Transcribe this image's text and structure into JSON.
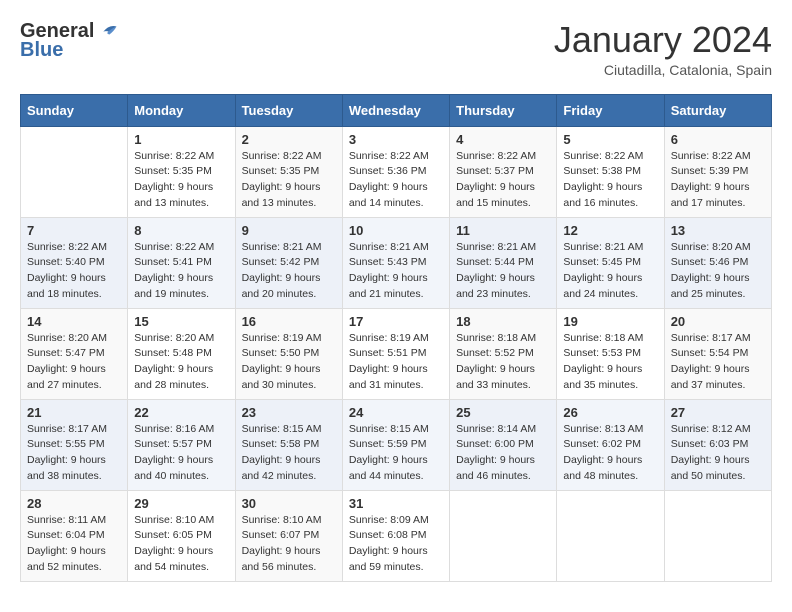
{
  "header": {
    "logo_general": "General",
    "logo_blue": "Blue",
    "month_title": "January 2024",
    "location": "Ciutadilla, Catalonia, Spain"
  },
  "days_of_week": [
    "Sunday",
    "Monday",
    "Tuesday",
    "Wednesday",
    "Thursday",
    "Friday",
    "Saturday"
  ],
  "weeks": [
    [
      {
        "day": "",
        "info": ""
      },
      {
        "day": "1",
        "info": "Sunrise: 8:22 AM\nSunset: 5:35 PM\nDaylight: 9 hours\nand 13 minutes."
      },
      {
        "day": "2",
        "info": "Sunrise: 8:22 AM\nSunset: 5:35 PM\nDaylight: 9 hours\nand 13 minutes."
      },
      {
        "day": "3",
        "info": "Sunrise: 8:22 AM\nSunset: 5:36 PM\nDaylight: 9 hours\nand 14 minutes."
      },
      {
        "day": "4",
        "info": "Sunrise: 8:22 AM\nSunset: 5:37 PM\nDaylight: 9 hours\nand 15 minutes."
      },
      {
        "day": "5",
        "info": "Sunrise: 8:22 AM\nSunset: 5:38 PM\nDaylight: 9 hours\nand 16 minutes."
      },
      {
        "day": "6",
        "info": "Sunrise: 8:22 AM\nSunset: 5:39 PM\nDaylight: 9 hours\nand 17 minutes."
      }
    ],
    [
      {
        "day": "7",
        "info": "Sunrise: 8:22 AM\nSunset: 5:40 PM\nDaylight: 9 hours\nand 18 minutes."
      },
      {
        "day": "8",
        "info": "Sunrise: 8:22 AM\nSunset: 5:41 PM\nDaylight: 9 hours\nand 19 minutes."
      },
      {
        "day": "9",
        "info": "Sunrise: 8:21 AM\nSunset: 5:42 PM\nDaylight: 9 hours\nand 20 minutes."
      },
      {
        "day": "10",
        "info": "Sunrise: 8:21 AM\nSunset: 5:43 PM\nDaylight: 9 hours\nand 21 minutes."
      },
      {
        "day": "11",
        "info": "Sunrise: 8:21 AM\nSunset: 5:44 PM\nDaylight: 9 hours\nand 23 minutes."
      },
      {
        "day": "12",
        "info": "Sunrise: 8:21 AM\nSunset: 5:45 PM\nDaylight: 9 hours\nand 24 minutes."
      },
      {
        "day": "13",
        "info": "Sunrise: 8:20 AM\nSunset: 5:46 PM\nDaylight: 9 hours\nand 25 minutes."
      }
    ],
    [
      {
        "day": "14",
        "info": "Sunrise: 8:20 AM\nSunset: 5:47 PM\nDaylight: 9 hours\nand 27 minutes."
      },
      {
        "day": "15",
        "info": "Sunrise: 8:20 AM\nSunset: 5:48 PM\nDaylight: 9 hours\nand 28 minutes."
      },
      {
        "day": "16",
        "info": "Sunrise: 8:19 AM\nSunset: 5:50 PM\nDaylight: 9 hours\nand 30 minutes."
      },
      {
        "day": "17",
        "info": "Sunrise: 8:19 AM\nSunset: 5:51 PM\nDaylight: 9 hours\nand 31 minutes."
      },
      {
        "day": "18",
        "info": "Sunrise: 8:18 AM\nSunset: 5:52 PM\nDaylight: 9 hours\nand 33 minutes."
      },
      {
        "day": "19",
        "info": "Sunrise: 8:18 AM\nSunset: 5:53 PM\nDaylight: 9 hours\nand 35 minutes."
      },
      {
        "day": "20",
        "info": "Sunrise: 8:17 AM\nSunset: 5:54 PM\nDaylight: 9 hours\nand 37 minutes."
      }
    ],
    [
      {
        "day": "21",
        "info": "Sunrise: 8:17 AM\nSunset: 5:55 PM\nDaylight: 9 hours\nand 38 minutes."
      },
      {
        "day": "22",
        "info": "Sunrise: 8:16 AM\nSunset: 5:57 PM\nDaylight: 9 hours\nand 40 minutes."
      },
      {
        "day": "23",
        "info": "Sunrise: 8:15 AM\nSunset: 5:58 PM\nDaylight: 9 hours\nand 42 minutes."
      },
      {
        "day": "24",
        "info": "Sunrise: 8:15 AM\nSunset: 5:59 PM\nDaylight: 9 hours\nand 44 minutes."
      },
      {
        "day": "25",
        "info": "Sunrise: 8:14 AM\nSunset: 6:00 PM\nDaylight: 9 hours\nand 46 minutes."
      },
      {
        "day": "26",
        "info": "Sunrise: 8:13 AM\nSunset: 6:02 PM\nDaylight: 9 hours\nand 48 minutes."
      },
      {
        "day": "27",
        "info": "Sunrise: 8:12 AM\nSunset: 6:03 PM\nDaylight: 9 hours\nand 50 minutes."
      }
    ],
    [
      {
        "day": "28",
        "info": "Sunrise: 8:11 AM\nSunset: 6:04 PM\nDaylight: 9 hours\nand 52 minutes."
      },
      {
        "day": "29",
        "info": "Sunrise: 8:10 AM\nSunset: 6:05 PM\nDaylight: 9 hours\nand 54 minutes."
      },
      {
        "day": "30",
        "info": "Sunrise: 8:10 AM\nSunset: 6:07 PM\nDaylight: 9 hours\nand 56 minutes."
      },
      {
        "day": "31",
        "info": "Sunrise: 8:09 AM\nSunset: 6:08 PM\nDaylight: 9 hours\nand 59 minutes."
      },
      {
        "day": "",
        "info": ""
      },
      {
        "day": "",
        "info": ""
      },
      {
        "day": "",
        "info": ""
      }
    ]
  ]
}
